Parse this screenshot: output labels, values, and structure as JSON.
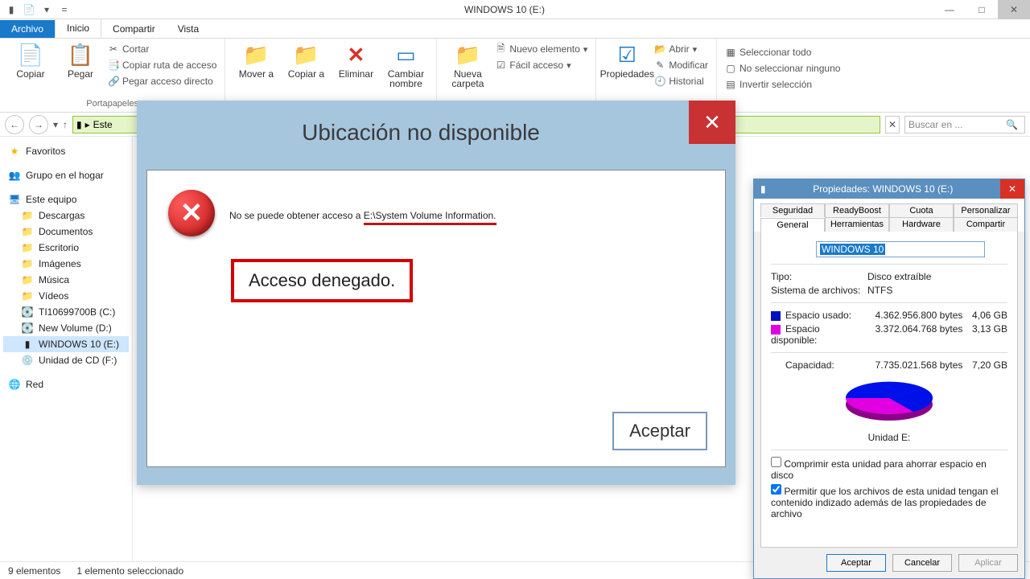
{
  "window": {
    "title": "WINDOWS 10 (E:)"
  },
  "ribbon_tabs": {
    "file": "Archivo",
    "home": "Inicio",
    "share": "Compartir",
    "view": "Vista"
  },
  "ribbon": {
    "clipboard": {
      "copy": "Copiar",
      "paste": "Pegar",
      "cut": "Cortar",
      "copy_path": "Copiar ruta de acceso",
      "paste_shortcut": "Pegar acceso directo",
      "caption": "Portapapeles"
    },
    "organize": {
      "move_to": "Mover a",
      "copy_to": "Copiar a",
      "delete": "Eliminar",
      "rename": "Cambiar nombre"
    },
    "new": {
      "new_folder": "Nueva carpeta",
      "new_item": "Nuevo elemento",
      "easy_access": "Fácil acceso"
    },
    "open": {
      "properties": "Propiedades",
      "open": "Abrir",
      "edit": "Modificar",
      "history": "Historial"
    },
    "select": {
      "select_all": "Seleccionar todo",
      "select_none": "No seleccionar ninguno",
      "invert": "Invertir selección"
    }
  },
  "nav": {
    "crumb1": "Este",
    "search_placeholder": "Buscar en ..."
  },
  "sidebar": {
    "favorites": "Favoritos",
    "homegroup": "Grupo en el hogar",
    "this_pc": "Este equipo",
    "downloads": "Descargas",
    "documents": "Documentos",
    "desktop": "Escritorio",
    "pictures": "Imágenes",
    "music": "Música",
    "videos": "Vídeos",
    "drive_c": "TI10699700B (C:)",
    "drive_d": "New Volume (D:)",
    "drive_e": "WINDOWS 10 (E:)",
    "drive_f": "Unidad de CD (F:)",
    "network": "Red"
  },
  "status": {
    "count": "9 elementos",
    "selected": "1 elemento seleccionado"
  },
  "error_dialog": {
    "title": "Ubicación no disponible",
    "line_prefix": "No se puede obtener acceso a ",
    "line_path": "E:\\System Volume Information.",
    "denied": "Acceso denegado.",
    "ok": "Aceptar"
  },
  "properties_dialog": {
    "title": "Propiedades: WINDOWS 10 (E:)",
    "tabs": {
      "security": "Seguridad",
      "readyboost": "ReadyBoost",
      "quota": "Cuota",
      "customize": "Personalizar",
      "general": "General",
      "tools": "Herramientas",
      "hardware": "Hardware",
      "sharing": "Compartir"
    },
    "volume_name": "WINDOWS 10",
    "type_label": "Tipo:",
    "type_value": "Disco extraíble",
    "fs_label": "Sistema de archivos:",
    "fs_value": "NTFS",
    "used_label": "Espacio usado:",
    "used_bytes": "4.362.956.800 bytes",
    "used_gb": "4,06 GB",
    "free_label": "Espacio disponible:",
    "free_bytes": "3.372.064.768 bytes",
    "free_gb": "3,13 GB",
    "cap_label": "Capacidad:",
    "cap_bytes": "7.735.021.568 bytes",
    "cap_gb": "7,20 GB",
    "drive_label": "Unidad E:",
    "compress": "Comprimir esta unidad para ahorrar espacio en disco",
    "index": "Permitir que los archivos de esta unidad tengan el contenido indizado además de las propiedades de archivo",
    "ok": "Aceptar",
    "cancel": "Cancelar",
    "apply": "Aplicar"
  }
}
